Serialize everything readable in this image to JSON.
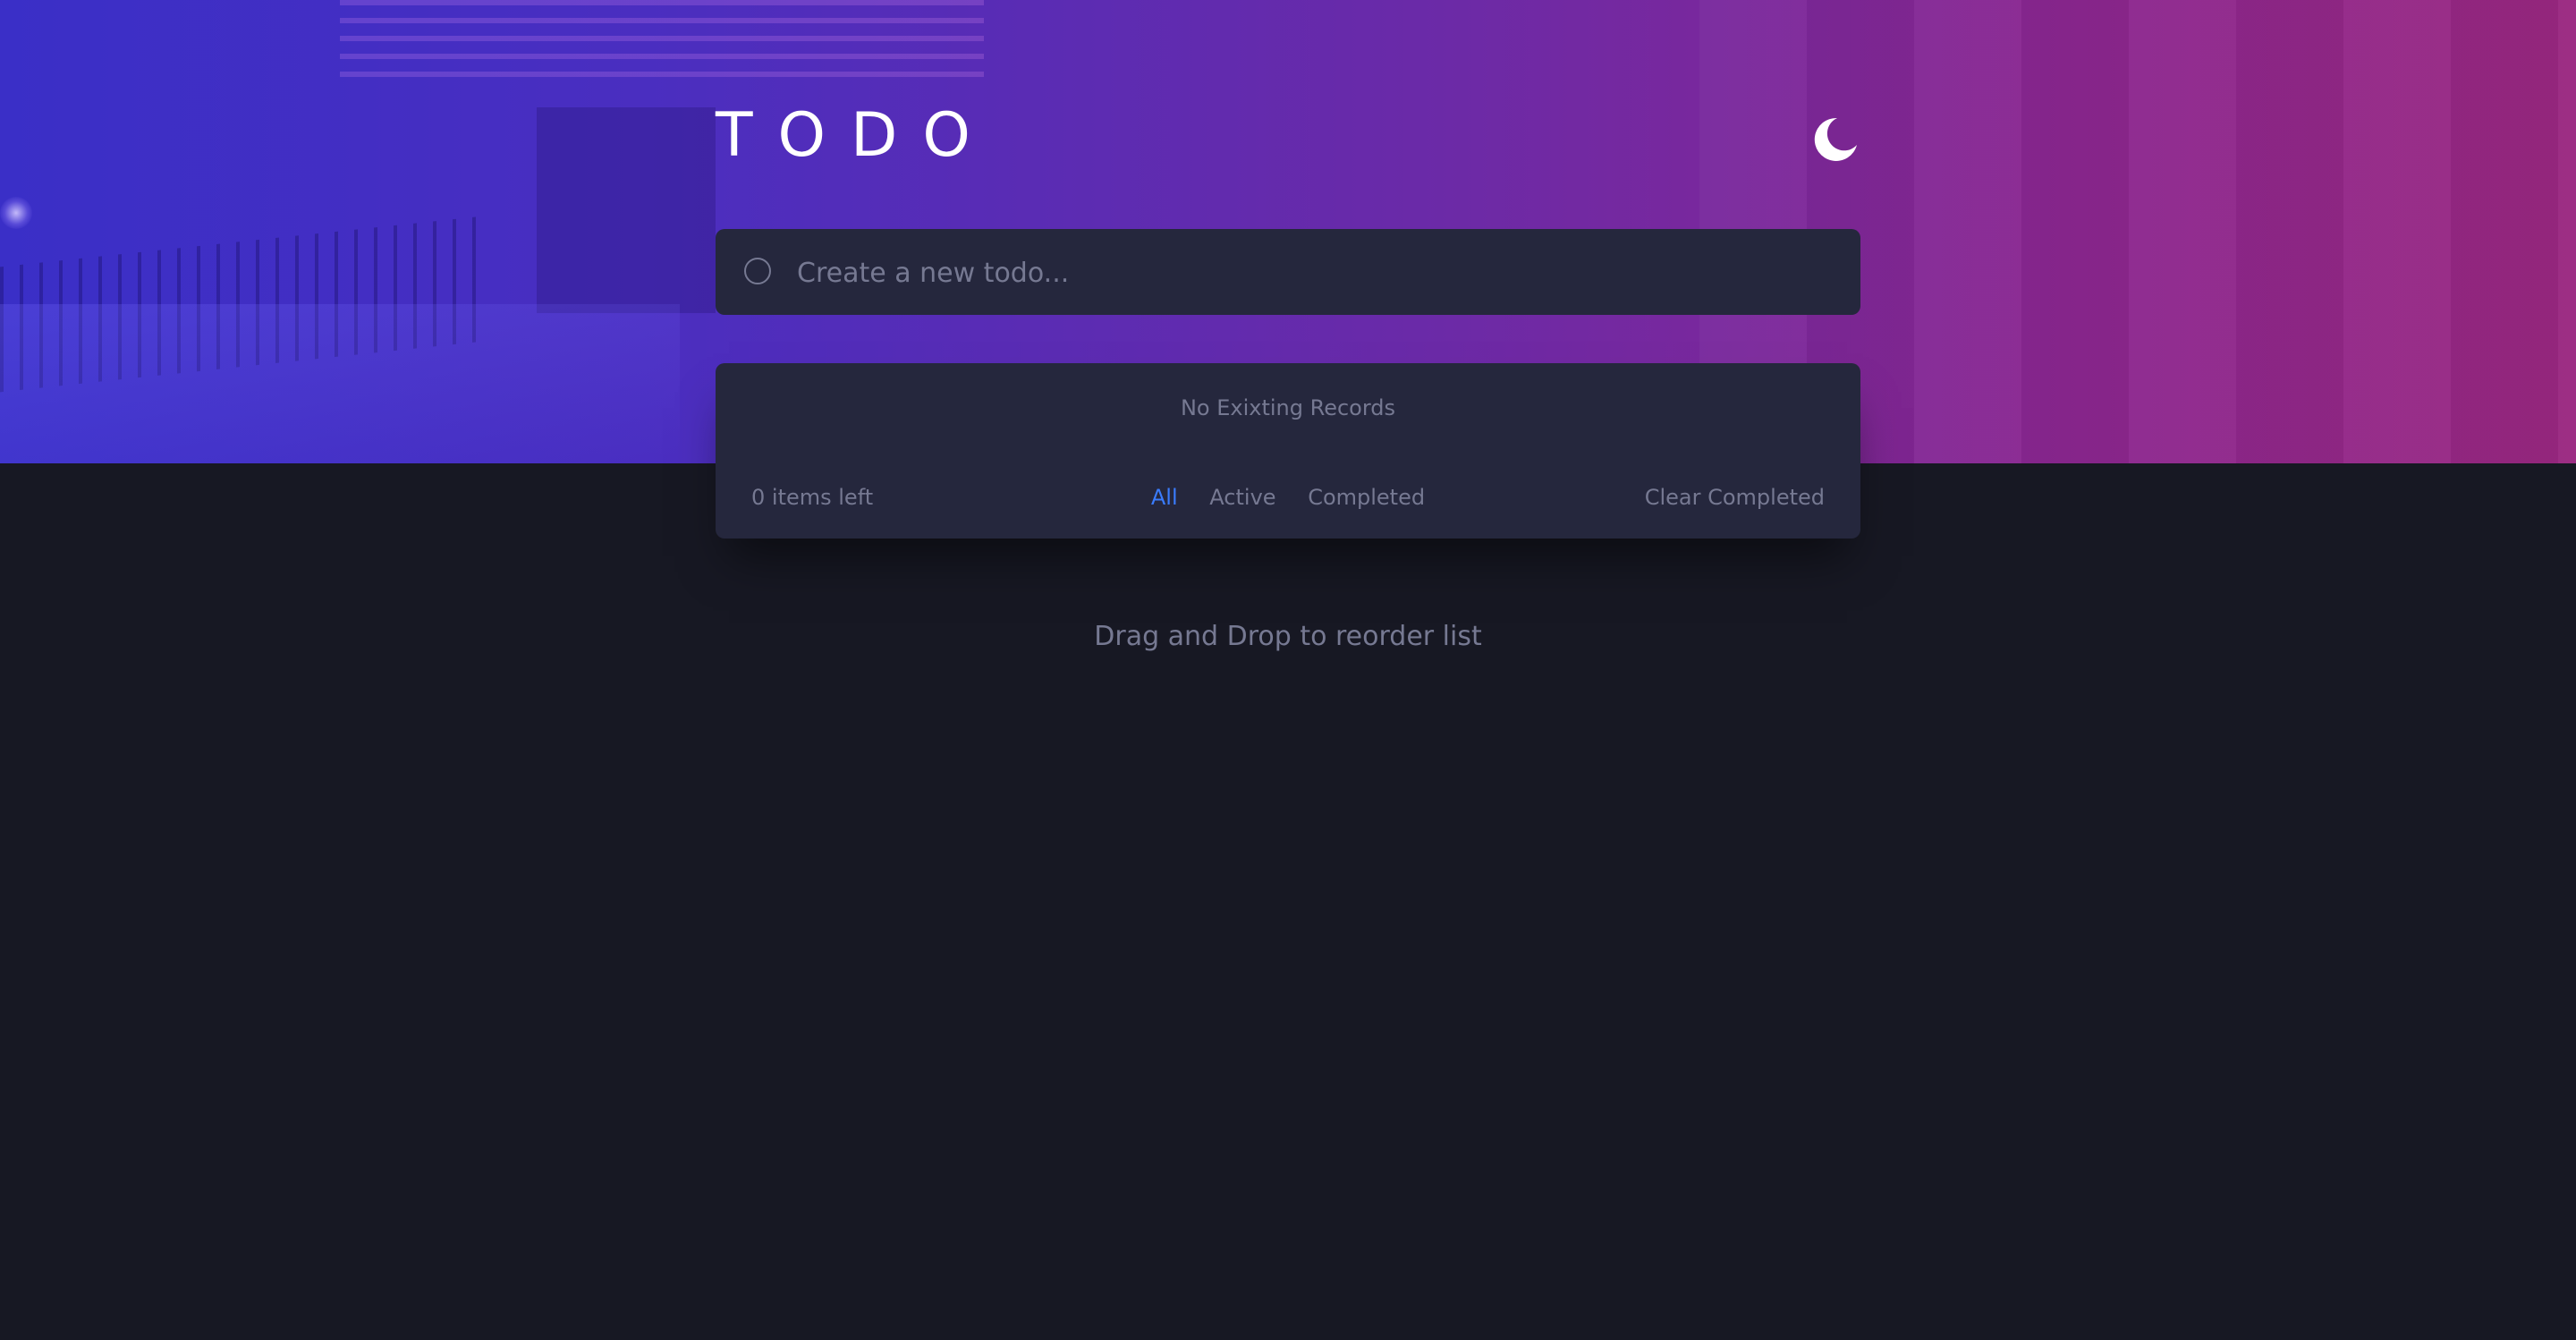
{
  "header": {
    "title": "TODO",
    "theme_icon": "moon-icon"
  },
  "new_todo": {
    "placeholder": "Create a new todo..."
  },
  "list": {
    "empty_message": "No Exixting Records"
  },
  "footer": {
    "items_left": "0 items left",
    "filters": [
      {
        "label": "All",
        "active": true
      },
      {
        "label": "Active",
        "active": false
      },
      {
        "label": "Completed",
        "active": false
      }
    ],
    "clear_label": "Clear Completed"
  },
  "hint": "Drag and Drop to reorder list",
  "colors": {
    "background": "#171823",
    "card": "#25273d",
    "muted_text": "#767992",
    "active_filter": "#3a7cfd",
    "gradient_start": "#3a2fc7",
    "gradient_end": "#9a2780"
  }
}
